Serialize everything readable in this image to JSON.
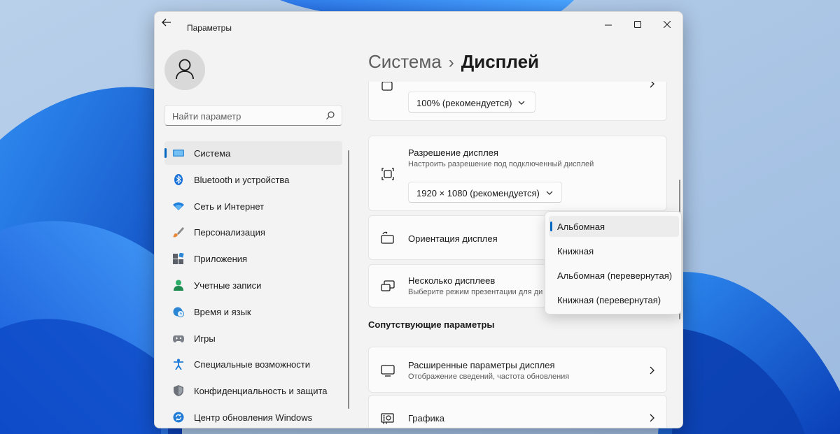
{
  "window": {
    "title": "Параметры"
  },
  "search": {
    "placeholder": "Найти параметр"
  },
  "sidebar": {
    "items": [
      {
        "label": "Система",
        "icon": "monitor-icon",
        "active": true
      },
      {
        "label": "Bluetooth и устройства",
        "icon": "bluetooth-icon"
      },
      {
        "label": "Сеть и Интернет",
        "icon": "wifi-icon"
      },
      {
        "label": "Персонализация",
        "icon": "brush-icon"
      },
      {
        "label": "Приложения",
        "icon": "apps-icon"
      },
      {
        "label": "Учетные записи",
        "icon": "person-icon"
      },
      {
        "label": "Время и язык",
        "icon": "globe-clock-icon"
      },
      {
        "label": "Игры",
        "icon": "gamepad-icon"
      },
      {
        "label": "Специальные возможности",
        "icon": "accessibility-icon"
      },
      {
        "label": "Конфиденциальность и защита",
        "icon": "shield-icon"
      },
      {
        "label": "Центр обновления Windows",
        "icon": "update-icon"
      }
    ]
  },
  "breadcrumb": {
    "parent": "Система",
    "separator": "›",
    "current": "Дисплей"
  },
  "main": {
    "scale_card": {
      "dropdown_value": "100% (рекомендуется)"
    },
    "resolution_card": {
      "title": "Разрешение дисплея",
      "subtitle": "Настроить разрешение под подключенный дисплей",
      "dropdown_value": "1920 × 1080 (рекомендуется)"
    },
    "orientation_card": {
      "title": "Ориентация дисплея"
    },
    "multi_display_card": {
      "title": "Несколько дисплеев",
      "subtitle": "Выберите режим презентации для ди"
    },
    "related_section_title": "Сопутствующие параметры",
    "advanced_display_card": {
      "title": "Расширенные параметры дисплея",
      "subtitle": "Отображение сведений, частота обновления"
    },
    "graphics_card": {
      "title": "Графика"
    }
  },
  "orientation_menu": {
    "options": [
      "Альбомная",
      "Книжная",
      "Альбомная (перевернутая)",
      "Книжная (перевернутая)"
    ],
    "selected": "Альбомная"
  },
  "colors": {
    "accent": "#0067c0",
    "window_bg": "#f3f3f3",
    "card_bg": "#fbfbfb"
  }
}
